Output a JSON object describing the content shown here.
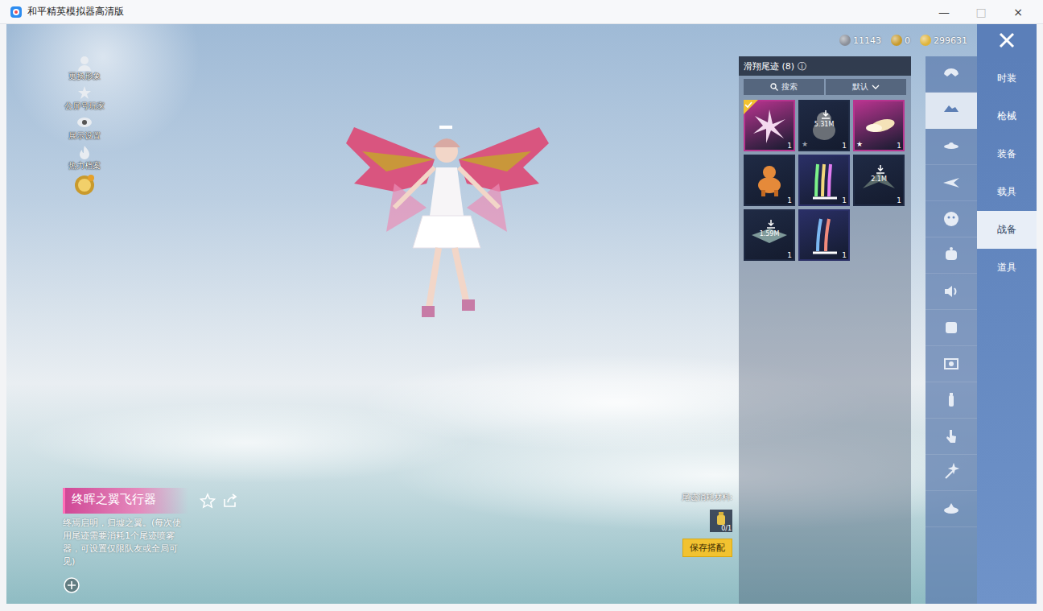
{
  "window": {
    "title": "和平精英模拟器高清版",
    "controls": [
      {
        "glyph": "—",
        "disabled": false
      },
      {
        "glyph": "□",
        "disabled": true
      },
      {
        "glyph": "×",
        "disabled": false
      }
    ]
  },
  "currency": [
    {
      "value": "11143",
      "color": "#8a8f99"
    },
    {
      "value": "0",
      "color": "#c79a2c"
    },
    {
      "value": "299631",
      "color": "#e0b43a"
    }
  ],
  "left_menu": [
    {
      "label": "更换形象"
    },
    {
      "label": "公屏号玩家"
    },
    {
      "label": "展示设置"
    },
    {
      "label": "热力档案"
    }
  ],
  "panel": {
    "title": "滑翔尾迹 (8)",
    "info_icon": "ⓘ",
    "search_placeholder": "搜索",
    "sort": "默认",
    "items": [
      {
        "count": "1",
        "selected": true,
        "size": "",
        "star": "none",
        "color": "#b8348f"
      },
      {
        "count": "1",
        "selected": false,
        "size": "5.31M",
        "star": "gray",
        "color": "#1f2a44"
      },
      {
        "count": "1",
        "selected": false,
        "size": "",
        "star": "white",
        "color": "#b8348f"
      },
      {
        "count": "1",
        "selected": false,
        "size": "",
        "star": "none",
        "color": "#1f2a44"
      },
      {
        "count": "1",
        "selected": false,
        "size": "",
        "star": "none",
        "color": "#2a2f66"
      },
      {
        "count": "1",
        "selected": false,
        "size": "2.1M",
        "star": "none",
        "color": "#1f2a44"
      },
      {
        "count": "1",
        "selected": false,
        "size": "1.59M",
        "star": "none",
        "color": "#1f2a44"
      },
      {
        "count": "1",
        "selected": false,
        "size": "",
        "star": "none",
        "color": "#2a2f66"
      }
    ]
  },
  "icon_tabs": [
    {
      "selected": false
    },
    {
      "selected": true
    },
    {
      "selected": false
    },
    {
      "selected": false
    },
    {
      "selected": false
    },
    {
      "selected": false
    },
    {
      "selected": false
    },
    {
      "selected": false
    },
    {
      "selected": false
    },
    {
      "selected": false
    },
    {
      "selected": false
    },
    {
      "selected": false
    },
    {
      "selected": false
    }
  ],
  "categories": [
    {
      "label": "时装",
      "selected": false
    },
    {
      "label": "枪械",
      "selected": false
    },
    {
      "label": "装备",
      "selected": false
    },
    {
      "label": "载具",
      "selected": false
    },
    {
      "label": "战备",
      "selected": true
    },
    {
      "label": "道具",
      "selected": false
    }
  ],
  "item": {
    "name": "终晖之翼飞行器",
    "description": "终焉启明，归墟之翼。(每次使用尾迹需要消耗1个尾迹喷雾器，可设置仅限队友或全局可见)"
  },
  "material": {
    "label": "尾迹消耗材料:",
    "count": "0/1"
  },
  "save_button": "保存搭配"
}
